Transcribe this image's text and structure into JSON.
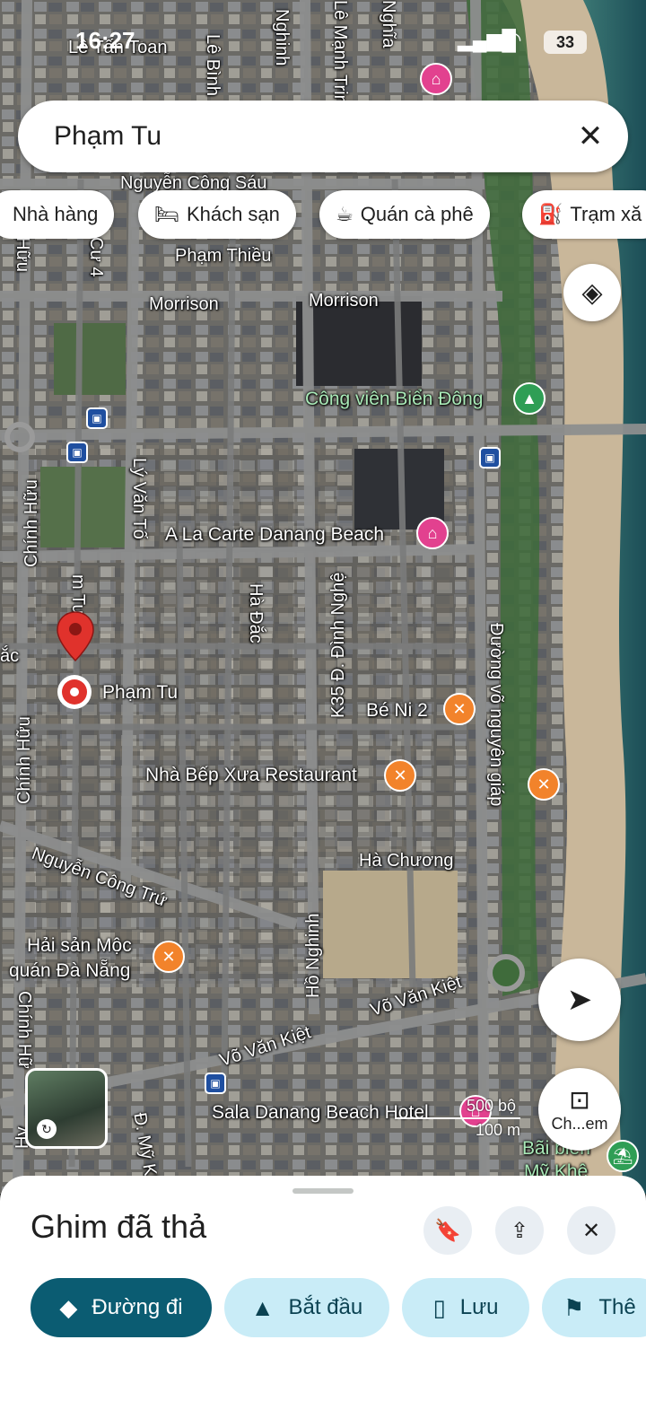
{
  "status_bar": {
    "time": "16:27",
    "battery": "33"
  },
  "search": {
    "query": "Phạm Tu",
    "clear_icon": "close-icon"
  },
  "chips": [
    {
      "label": "Nhà hàng",
      "icon": "restaurant-icon"
    },
    {
      "label": "Khách sạn",
      "icon": "bed-icon"
    },
    {
      "label": "Quán cà phê",
      "icon": "coffee-icon"
    },
    {
      "label": "Trạm xă",
      "icon": "gas-station-icon"
    }
  ],
  "map": {
    "streets": {
      "le_tan_toan": "Lê Tấn Toan",
      "le_binh": "Lê Bình",
      "nghinh": "Nghinh",
      "le_manh_trinh": "Lê Mạnh Trinh",
      "nghia": "Nghĩa",
      "nguyen_cong_sau": "Nguyễn Công Sáu",
      "pham_thieu": "Phạm Thiều",
      "morrison_1": "Morrison",
      "morrison_2": "Morrison",
      "hung_cu4": "Cư 4",
      "huu_top": "Hữu",
      "ly_van_to": "Lý Văn Tố",
      "chinh_huu_1": "Chính Hữu",
      "chinh_huu_2": "Chính Hữu",
      "chinh_huu_3": "Chính Hữ",
      "pham_tu_v": "m Tu",
      "ha_dac": "Hà Đắc",
      "k35_dinh_nghe": "K35 Đ. Đình Nghệ",
      "vo_nguyen_giap": "Đường võ nguyên giáp",
      "nguyen_cong_tru": "Nguyễn Công Trứ",
      "ho_nghinh": "Hồ Nghinh",
      "ha_chuong": "Hà Chương",
      "vo_van_kiet_1": "Võ Văn Kiệt",
      "vo_van_kiet_2": "Võ Văn Kiệt",
      "my_kh": "Đ. Mỹ Kh",
      "ac": "ắc",
      "hy": "Hy"
    },
    "places": {
      "park": "Công viên Biển Đông",
      "hotel_alacarte": "A La Carte Danang Beach",
      "pin": "Phạm Tu",
      "be_ni": "Bé Ni 2",
      "nha_bep": "Nhà Bếp Xưa Restaurant",
      "hai_san_1": "Hải sản Mộc",
      "hai_san_2": "quán Đà Nẵng",
      "sala": "Sala Danang Beach Hotel",
      "bai_bien_1": "Bãi biển",
      "bai_bien_2": "Mỹ Khê"
    },
    "scale": {
      "top": "500 bộ",
      "bottom": "100 m"
    },
    "lens_label": "Ch...em"
  },
  "sheet": {
    "title": "Ghim đã thả",
    "actions": [
      {
        "label": "Đường đi",
        "icon": "directions-icon"
      },
      {
        "label": "Bắt đầu",
        "icon": "navigation-arrow-icon"
      },
      {
        "label": "Lưu",
        "icon": "bookmark-icon"
      },
      {
        "label": "Thê",
        "icon": "flag-icon"
      }
    ]
  },
  "colors": {
    "accent": "#0b5c72",
    "secondary_button": "#c9ecf7",
    "pin": "#e0322c"
  }
}
